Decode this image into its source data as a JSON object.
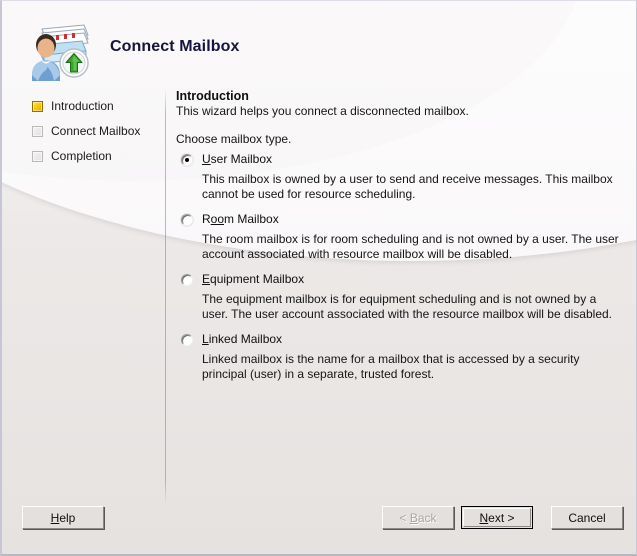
{
  "window": {
    "title": "Connect Mailbox",
    "icon": "connect-mailbox-icon"
  },
  "steps": {
    "items": [
      {
        "label": "Introduction",
        "state": "active"
      },
      {
        "label": "Connect Mailbox",
        "state": "inactive"
      },
      {
        "label": "Completion",
        "state": "inactive"
      }
    ]
  },
  "content": {
    "heading": "Introduction",
    "intro": "This wizard helps you connect a disconnected mailbox.",
    "choose_label": "Choose mailbox type.",
    "options": [
      {
        "accel": "U",
        "label_before": "",
        "label_after": "ser Mailbox",
        "full_label": "User Mailbox",
        "selected": true,
        "description": "This mailbox is owned by a user to send and receive messages. This mailbox cannot be used for resource scheduling."
      },
      {
        "accel": "oo",
        "label_before": "R",
        "label_after": "m Mailbox",
        "full_label": "Room Mailbox",
        "selected": false,
        "description": "The room mailbox is for room scheduling and is not owned by a user. The user account associated with resource mailbox will be disabled."
      },
      {
        "accel": "E",
        "label_before": "",
        "label_after": "quipment Mailbox",
        "full_label": "Equipment Mailbox",
        "selected": false,
        "description": "The equipment mailbox is for equipment scheduling and is not owned by a user. The user account associated with the resource mailbox will be disabled."
      },
      {
        "accel": "L",
        "label_before": "",
        "label_after": "inked Mailbox",
        "full_label": "Linked Mailbox",
        "selected": false,
        "description": "Linked mailbox is the name for a mailbox that is accessed by a security principal (user) in a separate, trusted forest."
      }
    ]
  },
  "footer": {
    "help": {
      "accel": "H",
      "before": "",
      "after": "elp",
      "full_label": "Help",
      "state": "enabled"
    },
    "back": {
      "accel": "B",
      "before": "< ",
      "after": "ack",
      "full_label": "< Back",
      "state": "disabled"
    },
    "next": {
      "accel": "N",
      "before": "",
      "after": "ext >",
      "full_label": "Next >",
      "state": "default"
    },
    "cancel": {
      "accel": "",
      "before": "Cancel",
      "after": "",
      "full_label": "Cancel",
      "state": "enabled"
    }
  },
  "colors": {
    "title": "#15153c",
    "step_active": "#f6c600",
    "background_top": "#faf8fa",
    "background_bottom": "#e6e2e0"
  }
}
